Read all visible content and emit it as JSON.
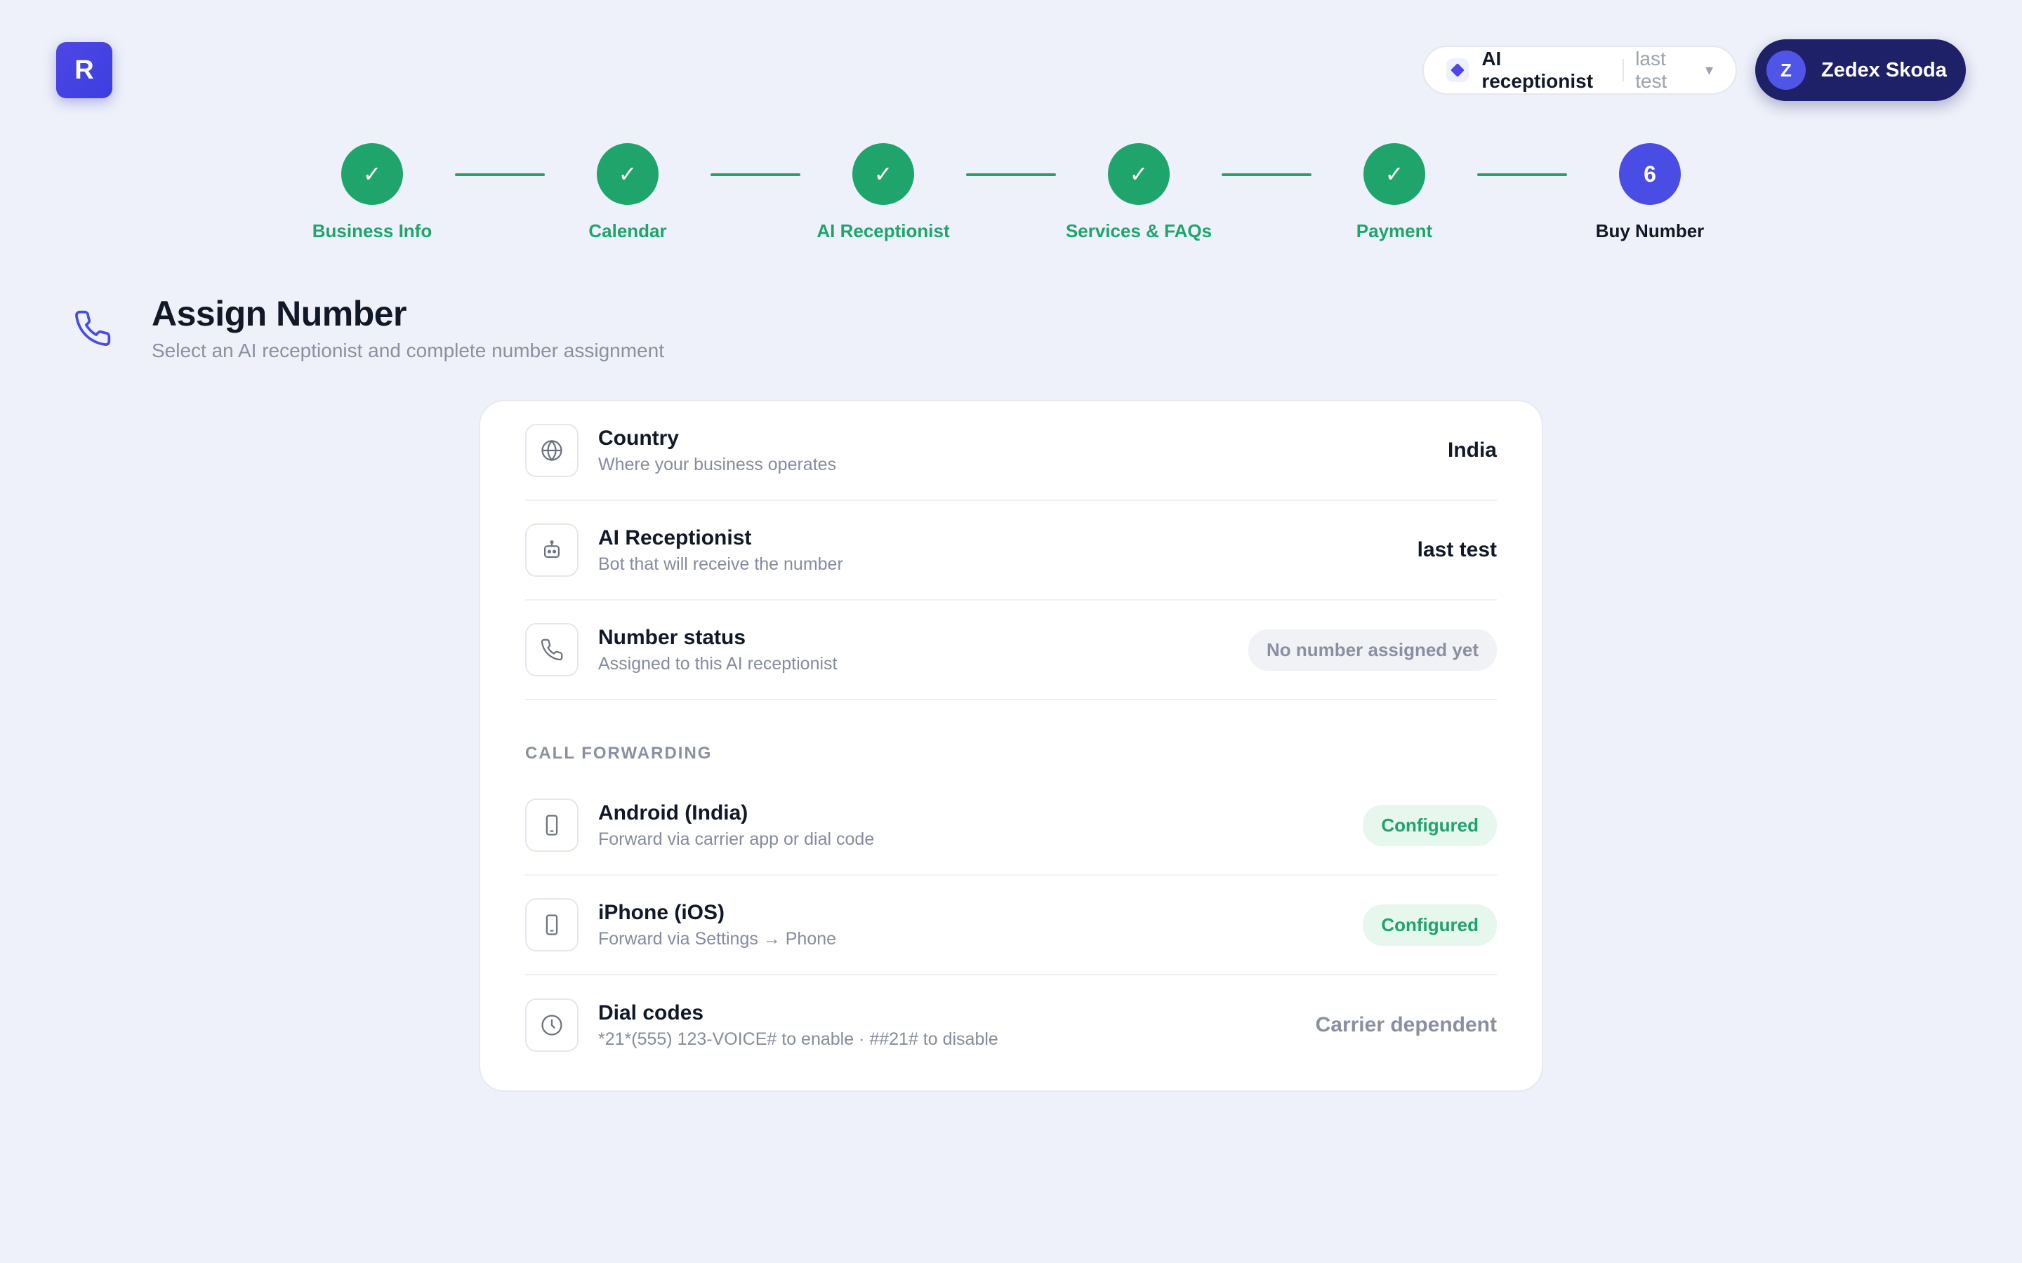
{
  "app": {
    "logo_letter": "R"
  },
  "selector": {
    "label": "AI receptionist",
    "value": "last test",
    "chevron": "▾"
  },
  "user": {
    "initial": "Z",
    "name": "Zedex Skoda"
  },
  "stepper": {
    "steps": [
      {
        "label": "Business Info",
        "status": "done",
        "mark": "✓"
      },
      {
        "label": "Calendar",
        "status": "done",
        "mark": "✓"
      },
      {
        "label": "AI Receptionist",
        "status": "done",
        "mark": "✓"
      },
      {
        "label": "Services & FAQs",
        "status": "done",
        "mark": "✓"
      },
      {
        "label": "Payment",
        "status": "done",
        "mark": "✓"
      },
      {
        "label": "Buy Number",
        "status": "current",
        "mark": "6"
      }
    ]
  },
  "header": {
    "title": "Assign Number",
    "subtitle": "Select an AI receptionist and complete number assignment"
  },
  "card": {
    "rows": [
      {
        "icon": "globe-icon",
        "title": "Country",
        "subtitle": "Where your business operates",
        "value": "India"
      },
      {
        "icon": "robot-icon",
        "title": "AI Receptionist",
        "subtitle": "Bot that will receive the number",
        "value": "last test"
      },
      {
        "icon": "phone-icon",
        "title": "Number status",
        "subtitle": "Assigned to this AI receptionist",
        "value": "No number assigned yet"
      }
    ],
    "section_label": "CALL FORWARDING",
    "forwarding": [
      {
        "icon": "smartphone-icon",
        "title": "Android (India)",
        "subtitle": "Forward via carrier app or dial code",
        "value": "Configured"
      },
      {
        "icon": "smartphone-icon",
        "title": "iPhone (iOS)",
        "subtitle": "Forward via Settings → Phone",
        "value": "Configured"
      },
      {
        "icon": "clock-icon",
        "title": "Dial codes",
        "subtitle": "*21*(555) 123-VOICE# to enable · ##21# to disable",
        "value": "Carrier dependent"
      }
    ]
  },
  "colors": {
    "background": "#eef1f9",
    "success": "#1fa56c",
    "accent": "#4a4de3",
    "navy": "#1e2167"
  }
}
